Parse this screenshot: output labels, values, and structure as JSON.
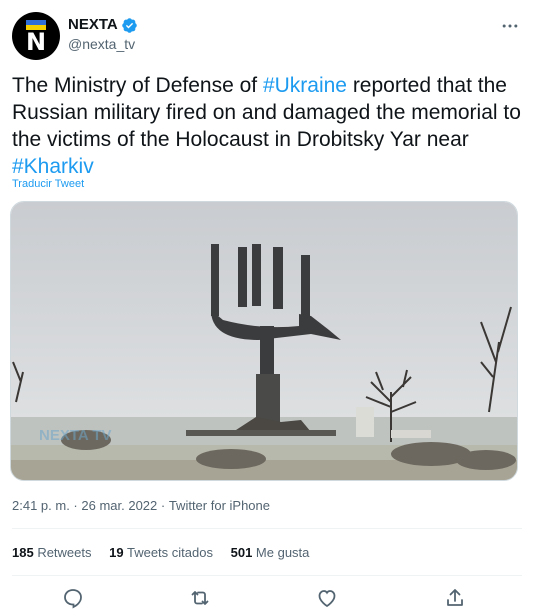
{
  "account": {
    "display_name": "NEXTA",
    "handle": "@nexta_tv",
    "avatar_letter": "N"
  },
  "tweet": {
    "parts": [
      {
        "text": "The Ministry of Defense of ",
        "hashtag": false
      },
      {
        "text": "#Ukraine",
        "hashtag": true
      },
      {
        "text": " reported that the Russian military fired on and damaged the memorial to the victims of the Holocaust in Drobitsky Yar near ",
        "hashtag": false
      },
      {
        "text": "#Kharkiv",
        "hashtag": true
      }
    ],
    "translate_label": "Traducir Tweet"
  },
  "media": {
    "watermark": "NEXTA TV"
  },
  "meta": {
    "time": "2:41 p. m.",
    "separator1": " · ",
    "date": "26 mar. 2022",
    "separator2": " · ",
    "source": "Twitter for iPhone"
  },
  "stats": {
    "retweets_count": "185",
    "retweets_label": " Retweets",
    "quotes_count": "19",
    "quotes_label": " Tweets citados",
    "likes_count": "501",
    "likes_label": " Me gusta"
  },
  "icons": {
    "reply": "reply-icon",
    "retweet": "retweet-icon",
    "like": "heart-icon",
    "share": "share-icon",
    "more": "more-options-icon",
    "verified": "verified-badge-icon"
  },
  "colors": {
    "accent": "#1d9bf0",
    "text": "#0f1419",
    "muted": "#536471"
  }
}
